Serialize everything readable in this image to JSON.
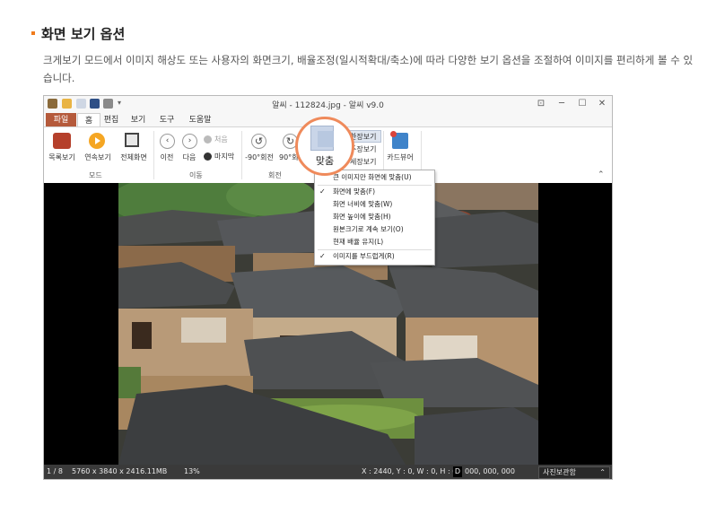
{
  "section": {
    "title": "화면 보기 옵션",
    "description": "크게보기 모드에서 이미지 해상도 또는 사용자의 화면크기, 배율조정(일시적확대/축소)에 따라 다양한 보기 옵션을 조절하여 이미지를 편리하게 볼 수 있습니다."
  },
  "window": {
    "title": "알씨 - 112824.jpg - 알씨 v9.0",
    "controls": [
      "⊡",
      "─",
      "☐",
      "✕"
    ]
  },
  "tabs": [
    "파일",
    "홈",
    "편집",
    "보기",
    "도구",
    "도움말"
  ],
  "ribbon": {
    "mode_group": {
      "label": "모드",
      "buttons": [
        "목록보기",
        "연속보기",
        "전체화면"
      ]
    },
    "move_group": {
      "label": "이동",
      "prev": "이전",
      "next": "다음",
      "first": "처음",
      "last": "마지막"
    },
    "rotate_group": {
      "label": "회전",
      "rotate_left": "-90°회전",
      "rotate_right": "90°회"
    },
    "fit_button": "맞춤",
    "view_options": [
      "한장보기",
      "두장보기",
      "세장보기"
    ],
    "card_viewer": "카드뷰어"
  },
  "fit_menu": {
    "items": [
      {
        "label": "큰 이미지만 화면에 맞춤(U)",
        "checked": false
      },
      {
        "label": "화면에 맞춤(F)",
        "checked": true
      },
      {
        "label": "화면 너비에 맞춤(W)",
        "checked": false
      },
      {
        "label": "화면 높이에 맞춤(H)",
        "checked": false
      },
      {
        "label": "원본크기로 계속 보기(O)",
        "checked": false
      },
      {
        "label": "현재 배율 유지(L)",
        "checked": false
      },
      {
        "label": "이미지를 부드럽게(R)",
        "checked": true
      }
    ]
  },
  "status_bar": {
    "index": "1 / 8",
    "dimensions": "5760 x 3840 x 24",
    "file_size": "16.11MB",
    "zoom": "13%",
    "coords": "X : 2440, Y : 0, W : 0, H : 0",
    "color_letter": "D",
    "color_value": "000, 000, 000",
    "photo_box": "사진보관함"
  },
  "colors": {
    "accent": "#f07b1b",
    "file_tab": "#b55a3b",
    "callout_ring": "#ef8a5b",
    "status_bg": "#3a3a3a"
  }
}
